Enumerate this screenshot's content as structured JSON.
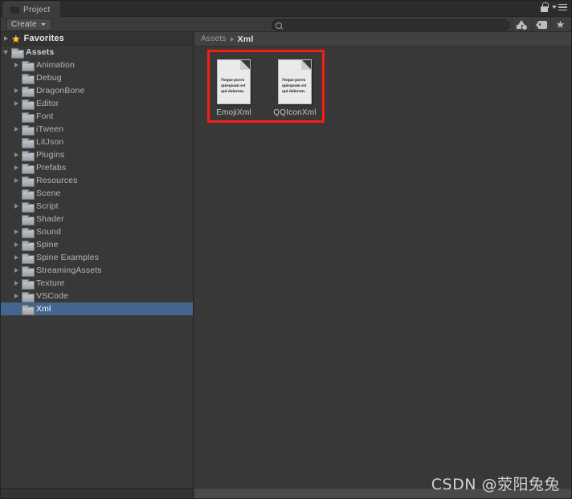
{
  "window": {
    "tab_label": "Project",
    "tab_icon": "folder-icon",
    "lock_icon": "lock-icon",
    "menu_icon": "hamburger-menu-icon"
  },
  "toolbar": {
    "create_label": "Create",
    "create_caret_icon": "chevron-down-icon",
    "search": {
      "icon": "search-icon",
      "value": "",
      "placeholder": ""
    },
    "filters": [
      {
        "name": "filter-by-type-button",
        "icon": "shapes-icon"
      },
      {
        "name": "filter-by-label-button",
        "icon": "tag-icon"
      },
      {
        "name": "filter-favorites-button",
        "icon": "star-icon",
        "glyph": "★"
      }
    ]
  },
  "sidebar": {
    "favorites": {
      "label": "Favorites",
      "arrow": "right",
      "icon": "star-icon",
      "glyph": "★"
    },
    "items": [
      {
        "label": "Assets",
        "depth": 0,
        "arrow": "down",
        "selected": false,
        "root": true
      },
      {
        "label": "Animation",
        "depth": 1,
        "arrow": "right",
        "selected": false
      },
      {
        "label": "Debug",
        "depth": 1,
        "arrow": "none",
        "selected": false
      },
      {
        "label": "DragonBone",
        "depth": 1,
        "arrow": "right",
        "selected": false
      },
      {
        "label": "Editor",
        "depth": 1,
        "arrow": "right",
        "selected": false
      },
      {
        "label": "Font",
        "depth": 1,
        "arrow": "none",
        "selected": false
      },
      {
        "label": "iTween",
        "depth": 1,
        "arrow": "right",
        "selected": false
      },
      {
        "label": "LitJson",
        "depth": 1,
        "arrow": "none",
        "selected": false
      },
      {
        "label": "Plugins",
        "depth": 1,
        "arrow": "right",
        "selected": false
      },
      {
        "label": "Prefabs",
        "depth": 1,
        "arrow": "right",
        "selected": false
      },
      {
        "label": "Resources",
        "depth": 1,
        "arrow": "right",
        "selected": false
      },
      {
        "label": "Scene",
        "depth": 1,
        "arrow": "none",
        "selected": false
      },
      {
        "label": "Script",
        "depth": 1,
        "arrow": "right",
        "selected": false
      },
      {
        "label": "Shader",
        "depth": 1,
        "arrow": "none",
        "selected": false
      },
      {
        "label": "Sound",
        "depth": 1,
        "arrow": "right",
        "selected": false
      },
      {
        "label": "Spine",
        "depth": 1,
        "arrow": "right",
        "selected": false
      },
      {
        "label": "Spine Examples",
        "depth": 1,
        "arrow": "right",
        "selected": false
      },
      {
        "label": "StreamingAssets",
        "depth": 1,
        "arrow": "right",
        "selected": false
      },
      {
        "label": "Texture",
        "depth": 1,
        "arrow": "right",
        "selected": false
      },
      {
        "label": "VSCode",
        "depth": 1,
        "arrow": "right",
        "selected": false
      },
      {
        "label": "Xml",
        "depth": 1,
        "arrow": "none",
        "selected": true
      }
    ]
  },
  "content": {
    "breadcrumb": [
      {
        "label": "Assets",
        "current": false
      },
      {
        "label": "Xml",
        "current": true
      }
    ],
    "assets": [
      {
        "label": "EmojiXml",
        "icon": "text-asset-icon",
        "preview_text": "Neque porro quisquam est qui dolorem."
      },
      {
        "label": "QQIconXml",
        "icon": "text-asset-icon",
        "preview_text": "Neque porro quisquam est qui dolorem."
      }
    ],
    "preview_lines": [
      "Neque porro",
      "quisquam est",
      "qui dolorem."
    ]
  },
  "annotation": {
    "color": "#f41f10",
    "shape": "rectangle"
  },
  "watermark": {
    "text": "CSDN @荥阳兔兔"
  },
  "colors": {
    "panel_bg": "#383838",
    "toolbar_bg": "#3b3b3b",
    "tabbar_bg": "#2c2c2c",
    "selection_blue": "#45658f",
    "annotation_red": "#f41f10",
    "star_gold": "#ffd02e"
  }
}
